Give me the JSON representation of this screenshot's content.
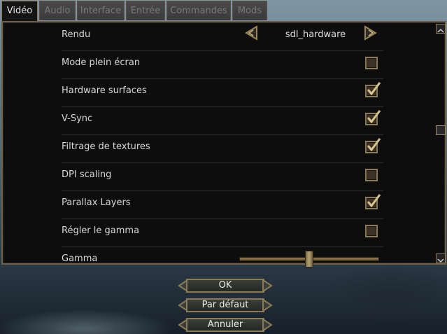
{
  "tabs": [
    {
      "label": "Vidéo",
      "active": true
    },
    {
      "label": "Audio",
      "active": false
    },
    {
      "label": "Interface",
      "active": false
    },
    {
      "label": "Entrée",
      "active": false
    },
    {
      "label": "Commandes",
      "active": false
    },
    {
      "label": "Mods",
      "active": false
    }
  ],
  "video": {
    "renderer": {
      "label": "Rendu",
      "value": "sdl_hardware"
    },
    "fullscreen": {
      "label": "Mode plein écran",
      "checked": false
    },
    "hw_surfaces": {
      "label": "Hardware surfaces",
      "checked": true
    },
    "vsync": {
      "label": "V-Sync",
      "checked": true
    },
    "texture_filter": {
      "label": "Filtrage de textures",
      "checked": true
    },
    "dpi_scaling": {
      "label": "DPI scaling",
      "checked": false
    },
    "parallax": {
      "label": "Parallax Layers",
      "checked": true
    },
    "adjust_gamma": {
      "label": "Régler le gamma",
      "checked": false
    },
    "gamma": {
      "label": "Gamma",
      "slider_fraction": 0.5
    }
  },
  "buttons": {
    "ok": "OK",
    "defaults": "Par défaut",
    "cancel": "Annuler"
  },
  "colors": {
    "accent": "#8a7a56",
    "panel": "#0d0d0d",
    "text": "#d8d8d8"
  }
}
